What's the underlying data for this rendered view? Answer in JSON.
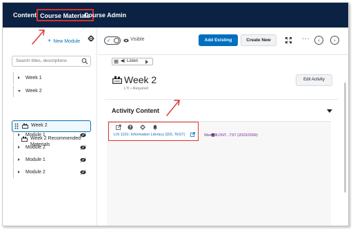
{
  "topnav": {
    "content": "Content",
    "course_materials": "Course Materials",
    "course_admin": "Course Admin"
  },
  "sidebar": {
    "new_module_plus": "+",
    "new_module": "New Module",
    "search_placeholder": "Search titles, descriptions",
    "items": [
      {
        "label": "Week 1",
        "expanded": false
      },
      {
        "label": "Week 2",
        "expanded": true
      },
      {
        "label": "Week 2",
        "selected": true
      },
      {
        "label": "Week 2 Recommended Materials"
      },
      {
        "label": "Module 1",
        "hidden": true
      },
      {
        "label": "Module 2",
        "hidden": true
      },
      {
        "label": "Module 1",
        "hidden": true
      },
      {
        "label": "Module 2",
        "hidden": true
      }
    ]
  },
  "toolbar": {
    "visible_label": "Visible",
    "add_existing": "Add Existing",
    "create_new": "Create New",
    "more": "···",
    "prev": "‹",
    "next": "›",
    "toggle_check": "✓"
  },
  "listen": {
    "speaker": "◀)",
    "label": "Listen"
  },
  "activity": {
    "title": "Week 2",
    "subtitle": "LTI  •  Required",
    "edit_button": "Edit Activity"
  },
  "content": {
    "header": "Activity Content",
    "link_text": "LIS 1101: Information Literacy (D2L TEST)",
    "week": "Week 2",
    "course": "LDNT...TST (2023/2099)"
  },
  "colors": {
    "nav_bg": "#0b2244",
    "primary": "#006fbf",
    "annotation_red": "#d9322d",
    "course_purple": "#7a2b8f"
  }
}
